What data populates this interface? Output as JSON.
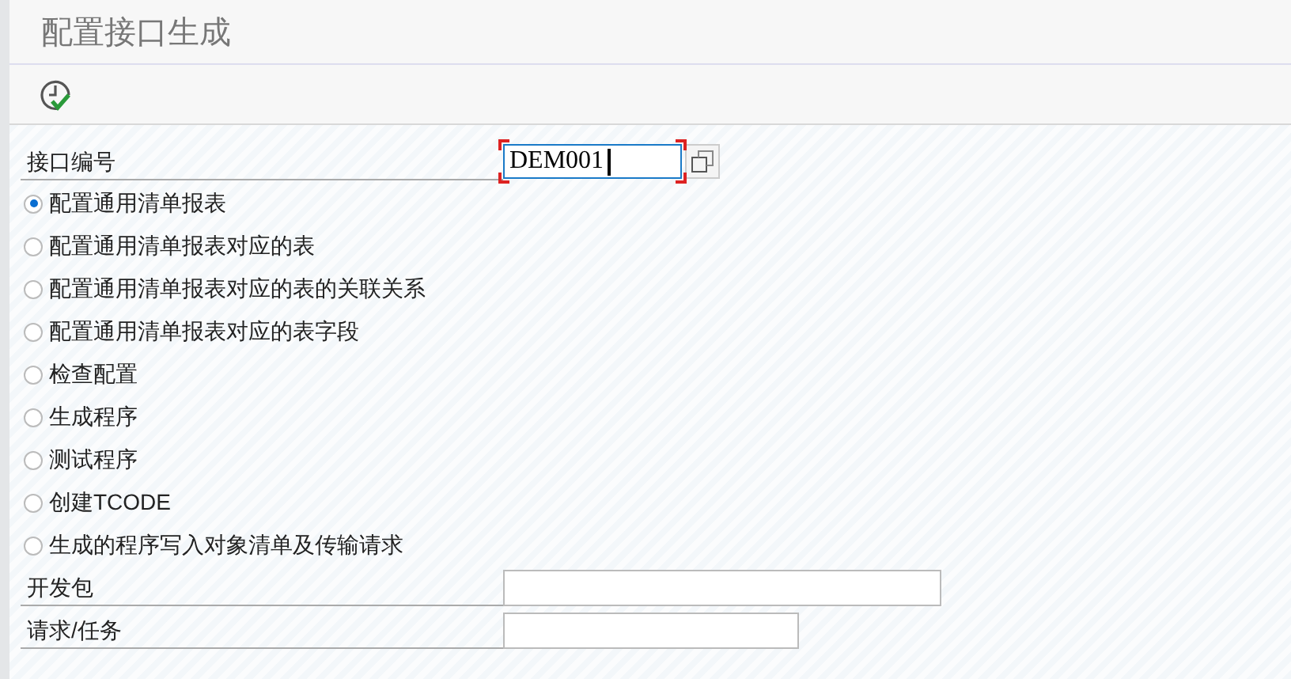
{
  "window": {
    "title": "配置接口生成"
  },
  "toolbar": {
    "buttons": [
      {
        "kind": "execute"
      }
    ]
  },
  "interface_number": {
    "label": "接口编号",
    "value": "DEM001"
  },
  "options": [
    {
      "label": "配置通用清单报表",
      "selected": true
    },
    {
      "label": "配置通用清单报表对应的表",
      "selected": false
    },
    {
      "label": "配置通用清单报表对应的表的关联关系",
      "selected": false
    },
    {
      "label": "配置通用清单报表对应的表字段",
      "selected": false
    },
    {
      "label": "检查配置",
      "selected": false
    },
    {
      "label": "生成程序",
      "selected": false
    },
    {
      "label": "测试程序",
      "selected": false
    },
    {
      "label": "创建TCODE",
      "selected": false
    },
    {
      "label": "生成的程序写入对象清单及传输请求",
      "selected": false
    }
  ],
  "fields": [
    {
      "label": "开发包",
      "kind": "long"
    },
    {
      "label": "请求/任务",
      "kind": "short"
    }
  ]
}
